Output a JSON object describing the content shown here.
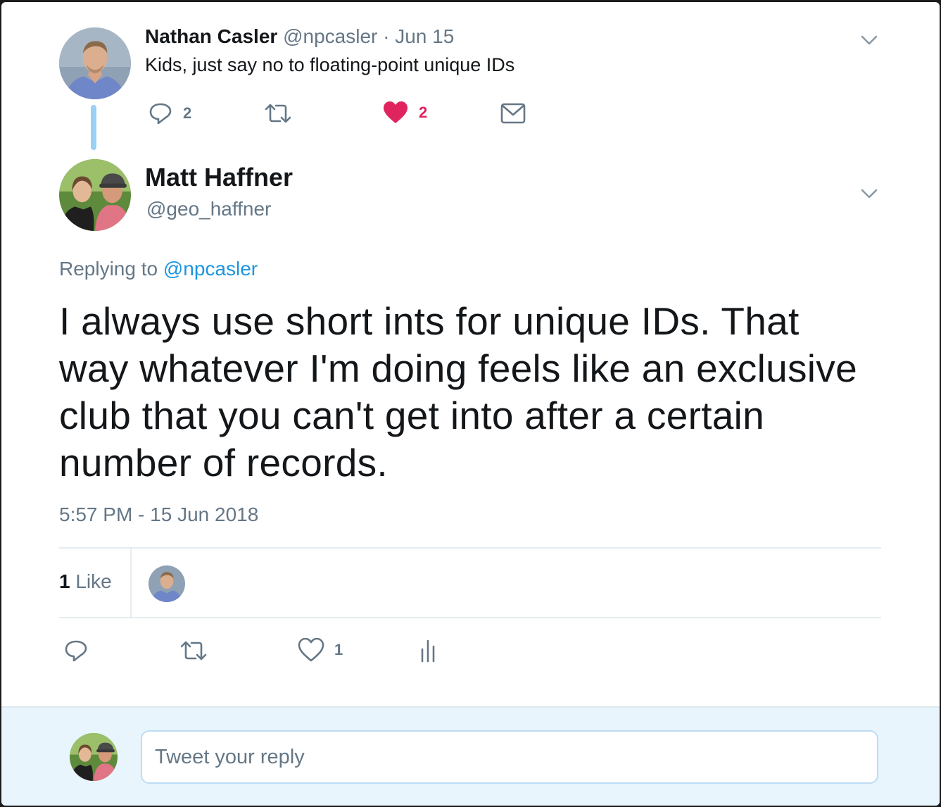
{
  "parent_tweet": {
    "author_name": "Nathan Casler",
    "handle": "@npcasler",
    "separator": "·",
    "date": "Jun 15",
    "text": "Kids, just say no to floating-point unique IDs",
    "actions": {
      "reply_count": "2",
      "like_count": "2"
    }
  },
  "main_tweet": {
    "author_name": "Matt Haffner",
    "handle": "@geo_haffner",
    "replying_prefix": "Replying to",
    "replying_to": "@npcasler",
    "text": "I always use short ints for unique IDs. That way whatever I'm doing feels like an exclusive club that you can't get into after a certain number of records.",
    "timestamp": "5:57 PM - 15 Jun 2018",
    "likes": {
      "count": "1",
      "label": "Like"
    },
    "actions": {
      "like_count": "1"
    }
  },
  "reply_box": {
    "placeholder": "Tweet your reply"
  },
  "colors": {
    "accent": "#1b95e0",
    "like": "#e0245e",
    "muted": "#657786",
    "text": "#14171a",
    "reply_bar_bg": "#e8f5fd"
  },
  "icons": [
    "chevron-down-icon",
    "reply-icon",
    "retweet-icon",
    "heart-icon",
    "mail-icon",
    "analytics-icon"
  ]
}
